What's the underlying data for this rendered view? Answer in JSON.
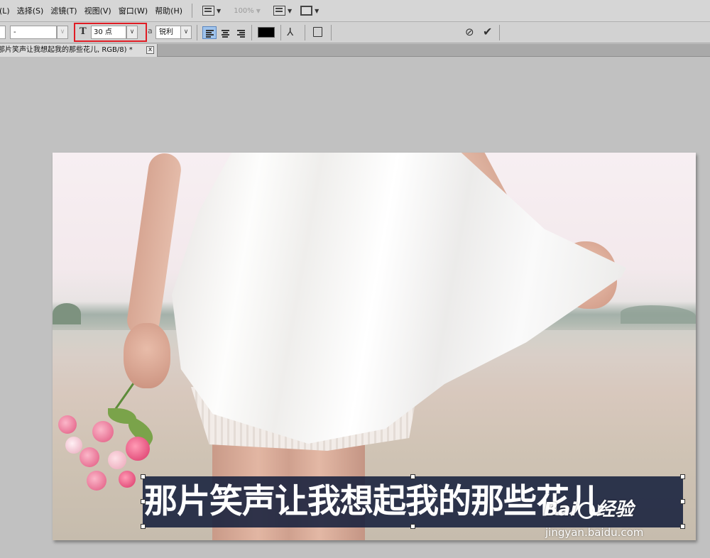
{
  "menubar": {
    "items": [
      {
        "label": "(L)"
      },
      {
        "label": "选择(S)"
      },
      {
        "label": "滤镜(T)"
      },
      {
        "label": "视图(V)"
      },
      {
        "label": "窗口(W)"
      },
      {
        "label": "帮助(H)"
      }
    ],
    "zoom_level": "100%"
  },
  "options": {
    "font_style_value": "-",
    "font_size_value": "30 点",
    "aa_prefix": "a",
    "antialias_value": "锐利",
    "text_color": "#000000",
    "highlight_color": "#e01c24"
  },
  "document": {
    "tab_title": "那片笑声让我想起我的那些花儿, RGB/8) *",
    "tab_close": "x"
  },
  "canvas": {
    "text_layer": "那片笑声让我想起我的那些花儿"
  },
  "watermark": {
    "logo_left": "Bai",
    "logo_right": "经验",
    "url": "jingyan.baidu.com"
  }
}
